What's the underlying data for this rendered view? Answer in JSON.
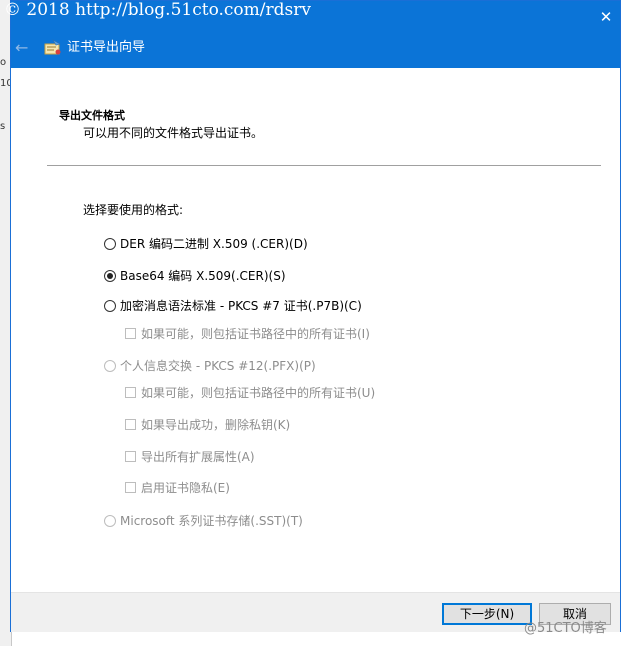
{
  "watermark": {
    "top": "© 2018 http://blog.51cto.com/rdsrv",
    "bottom": "@51CTO博客"
  },
  "background_window": {
    "glyphs": [
      "o",
      "10",
      "s"
    ]
  },
  "titlebar": {
    "title": "证书导出向导",
    "close_symbol": "✕",
    "back_symbol": "←"
  },
  "section": {
    "title": "导出文件格式",
    "subtitle": "可以用不同的文件格式导出证书。"
  },
  "prompt": "选择要使用的格式:",
  "options": {
    "der": {
      "label": "DER 编码二进制 X.509 (.CER)(D)",
      "checked": false,
      "enabled": true
    },
    "base64": {
      "label": "Base64 编码 X.509(.CER)(S)",
      "checked": true,
      "enabled": true
    },
    "pkcs7": {
      "label": "加密消息语法标准 - PKCS #7 证书(.P7B)(C)",
      "checked": false,
      "enabled": true
    },
    "pkcs7_include_all": {
      "label": "如果可能，则包括证书路径中的所有证书(I)",
      "enabled": false
    },
    "pfx": {
      "label": "个人信息交换 - PKCS #12(.PFX)(P)",
      "checked": false,
      "enabled": false
    },
    "pfx_include_all": {
      "label": "如果可能，则包括证书路径中的所有证书(U)",
      "enabled": false
    },
    "pfx_delete_key": {
      "label": "如果导出成功，删除私钥(K)",
      "enabled": false
    },
    "pfx_export_ext": {
      "label": "导出所有扩展属性(A)",
      "enabled": false
    },
    "pfx_privacy": {
      "label": "启用证书隐私(E)",
      "enabled": false
    },
    "sst": {
      "label": "Microsoft 系列证书存储(.SST)(T)",
      "checked": false,
      "enabled": false
    }
  },
  "buttons": {
    "next": "下一步(N)",
    "cancel": "取消"
  },
  "colors": {
    "titlebar": "#0b74d7",
    "accent": "#0078d7",
    "disabled_text": "#8d8d8d"
  }
}
